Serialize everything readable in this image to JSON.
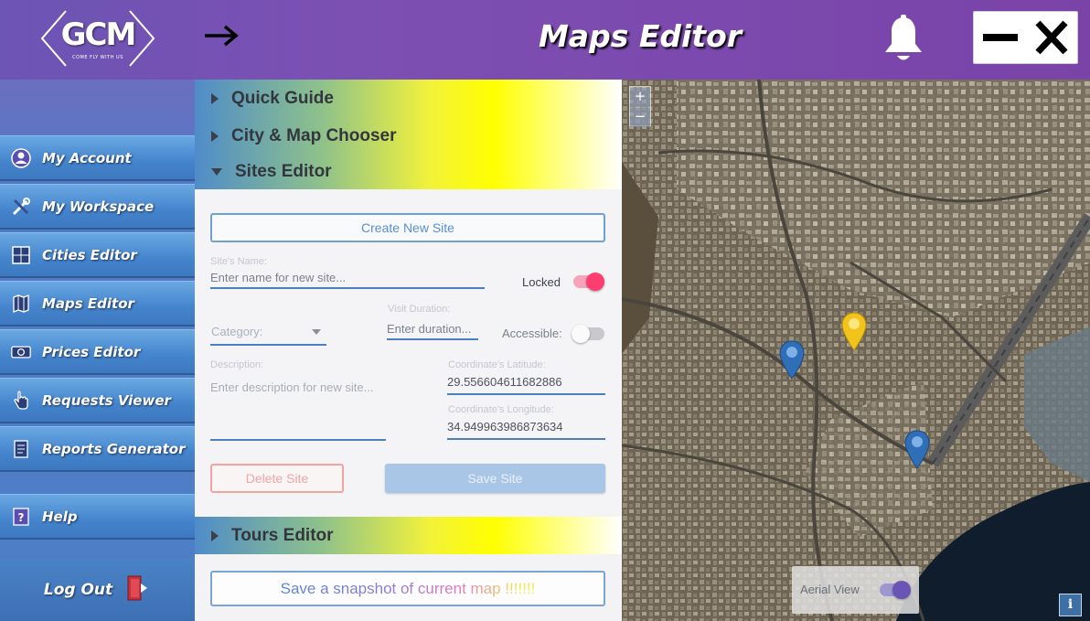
{
  "header": {
    "logo_text": "GCM",
    "logo_tagline": "COME FLY WITH US",
    "title": "Maps Editor"
  },
  "sidebar": {
    "items": [
      {
        "label": "My Account",
        "icon": "user-circle-icon"
      },
      {
        "label": "My Workspace",
        "icon": "tools-icon"
      },
      {
        "label": "Cities Editor",
        "icon": "city-grid-icon"
      },
      {
        "label": "Maps Editor",
        "icon": "map-icon"
      },
      {
        "label": "Prices Editor",
        "icon": "money-icon"
      },
      {
        "label": "Requests Viewer",
        "icon": "hand-pointer-icon"
      },
      {
        "label": "Reports Generator",
        "icon": "report-icon"
      }
    ],
    "help_label": "Help",
    "logout_label": "Log Out"
  },
  "accordion": {
    "quick_guide": "Quick Guide",
    "city_map_chooser": "City & Map Chooser",
    "sites_editor": "Sites Editor",
    "tours_editor": "Tours Editor"
  },
  "sites_editor": {
    "create_button": "Create New Site",
    "name_label": "Site's Name:",
    "name_placeholder": "Enter name for new site...",
    "locked_label": "Locked",
    "locked_on": true,
    "category_placeholder": "Category:",
    "visit_duration_label": "Visit Duration:",
    "visit_duration_placeholder": "Enter duration...",
    "accessible_label": "Accessible:",
    "accessible_on": false,
    "description_label": "Description:",
    "description_placeholder": "Enter description for new site...",
    "latitude_label": "Coordinate's Latitude:",
    "latitude_value": "29.556604611682886",
    "longitude_label": "Coordinate's Longitude:",
    "longitude_value": "34.949963986873634",
    "delete_button": "Delete Site",
    "save_button": "Save Site"
  },
  "snapshot_button": "Save a snapshot of current map !!!!!!!",
  "map": {
    "zoom_in": "+",
    "zoom_out": "−",
    "aerial_label": "Aerial View",
    "aerial_on": true,
    "info": "i",
    "markers": [
      "blue",
      "yellow",
      "blue"
    ]
  },
  "colors": {
    "accent_blue": "#4a7fc2",
    "toggle_on": "#ff3d70",
    "marker_blue": "#2f6fb8",
    "marker_yellow": "#f2c31a"
  }
}
